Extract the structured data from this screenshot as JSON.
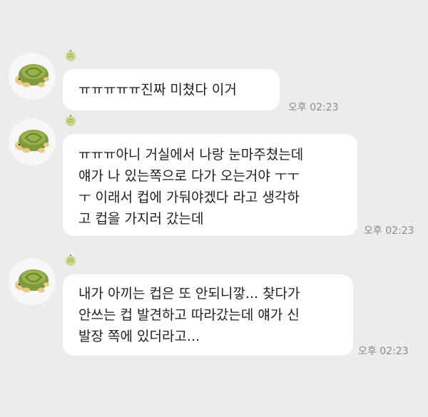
{
  "messages": [
    {
      "avatar_icon": "turtle-icon",
      "badge_icon": "melon-badge-icon",
      "text": "ㅠㅠㅠㅠㅠ진짜 미쳤다 이거",
      "time": "오후 02:23"
    },
    {
      "avatar_icon": "turtle-icon",
      "badge_icon": "melon-badge-icon",
      "text": "ㅠㅠㅠ아니 거실에서 나랑 눈마주쳤는데\n얘가 나 있는쪽으로 다가 오는거야 ㅜㅜ\nㅜ 이래서 컵에 가둬야겠다 라고 생각하\n고 컵을 가지러 갔는데",
      "time": "오후 02:23"
    },
    {
      "avatar_icon": "turtle-icon",
      "badge_icon": "melon-badge-icon",
      "text": "내가 아끼는 컵은 또 안되니깧... 찾다가\n안쓰는 컵 발견하고 따라갔는데 얘가 신\n발장 쪽에 있더라고...",
      "time": "오후 02:23"
    }
  ],
  "colors": {
    "background": "#ececec",
    "bubble": "#ffffff",
    "text": "#1f1f1f",
    "time": "#8a8a8a"
  }
}
